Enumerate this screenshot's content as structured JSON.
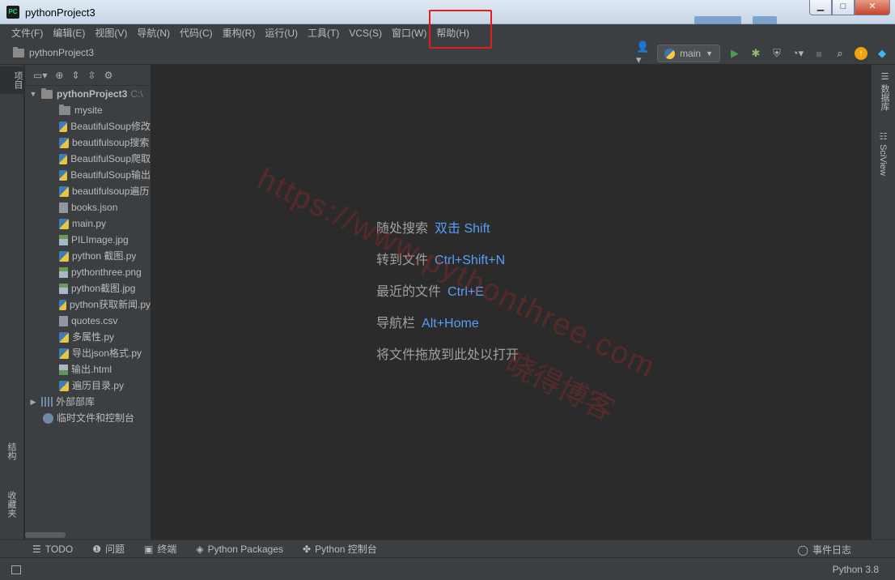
{
  "window": {
    "title": "pythonProject3",
    "app_icon_text": "PC"
  },
  "menu": [
    "文件(F)",
    "编辑(E)",
    "视图(V)",
    "导航(N)",
    "代码(C)",
    "重构(R)",
    "运行(U)",
    "工具(T)",
    "VCS(S)",
    "窗口(W)",
    "帮助(H)"
  ],
  "breadcrumb": "pythonProject3",
  "run_config": {
    "label": "main"
  },
  "left_tabs": {
    "project": "项目",
    "structure": "结构",
    "favorites": "收藏夹"
  },
  "right_tabs": {
    "database": "数据库",
    "sciview": "SciView"
  },
  "project_tree": {
    "root": "pythonProject3",
    "root_hint": "C:\\",
    "items": [
      {
        "name": "mysite",
        "type": "folder"
      },
      {
        "name": "BeautifulSoup修改",
        "type": "py"
      },
      {
        "name": "beautifulsoup搜索",
        "type": "py"
      },
      {
        "name": "BeautifulSoup爬取",
        "type": "py"
      },
      {
        "name": "BeautifulSoup输出",
        "type": "py"
      },
      {
        "name": "beautifulsoup遍历",
        "type": "py"
      },
      {
        "name": "books.json",
        "type": "file"
      },
      {
        "name": "main.py",
        "type": "py"
      },
      {
        "name": "PILImage.jpg",
        "type": "img"
      },
      {
        "name": "python 截图.py",
        "type": "py"
      },
      {
        "name": "pythonthree.png",
        "type": "img"
      },
      {
        "name": "python截图.jpg",
        "type": "img"
      },
      {
        "name": "python获取新闻.py",
        "type": "py"
      },
      {
        "name": "quotes.csv",
        "type": "file"
      },
      {
        "name": "多属性.py",
        "type": "py"
      },
      {
        "name": "导出json格式.py",
        "type": "py"
      },
      {
        "name": "输出.html",
        "type": "html"
      },
      {
        "name": "遍历目录.py",
        "type": "py"
      }
    ],
    "external_libs": "外部部库",
    "scratches": "临时文件和控制台"
  },
  "hints": [
    {
      "text": "随处搜索",
      "key": "双击 Shift"
    },
    {
      "text": "转到文件",
      "key": "Ctrl+Shift+N"
    },
    {
      "text": "最近的文件",
      "key": "Ctrl+E"
    },
    {
      "text": "导航栏",
      "key": "Alt+Home"
    },
    {
      "text": "将文件拖放到此处以打开",
      "key": ""
    }
  ],
  "watermark": {
    "line1": "https://www.pythonthree.com",
    "line2": "晓得博客"
  },
  "bottom_tabs": {
    "todo": "TODO",
    "problems": "问题",
    "terminal": "终端",
    "packages": "Python Packages",
    "console": "Python 控制台",
    "event_log": "事件日志"
  },
  "status": {
    "interpreter": "Python 3.8"
  }
}
